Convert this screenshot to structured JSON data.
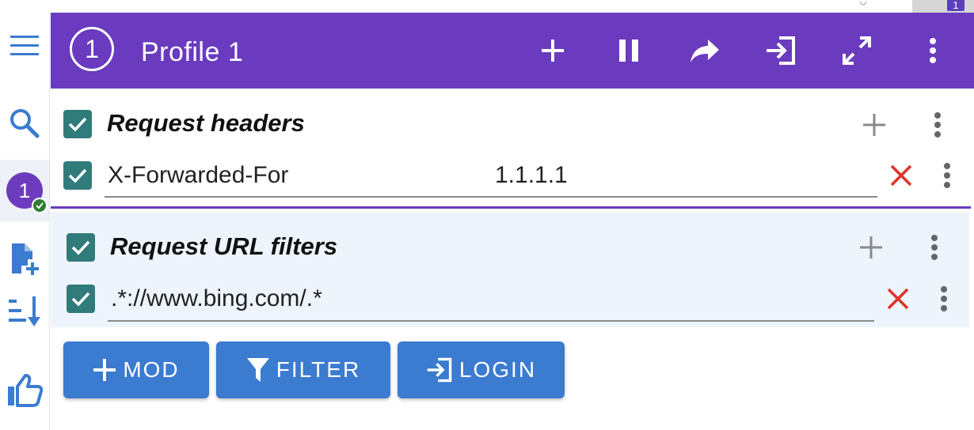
{
  "browser": {
    "extension_badge": "1"
  },
  "sidebar": {
    "profile_number": "1",
    "icons": [
      "menu-icon",
      "search-icon",
      "profile-avatar",
      "add-file-icon",
      "sort-icon",
      "thumbs-up-icon"
    ]
  },
  "header": {
    "profile_number": "1",
    "title": "Profile 1",
    "actions": [
      "add-icon",
      "pause-icon",
      "share-icon",
      "login-icon",
      "fullscreen-icon",
      "more-vert-icon"
    ],
    "background_color": "#6a3bbf"
  },
  "sections": [
    {
      "title": "Request headers",
      "checked": true,
      "rows": [
        {
          "checked": true,
          "name": "X-Forwarded-For",
          "value": "1.1.1.1"
        }
      ]
    },
    {
      "title": "Request URL filters",
      "checked": true,
      "rows": [
        {
          "checked": true,
          "name": ".*://www.bing.com/.*"
        }
      ]
    }
  ],
  "buttons": {
    "mod_label": "MOD",
    "filter_label": "FILTER",
    "login_label": "LOGIN"
  },
  "colors": {
    "checkbox": "#327b7b",
    "button": "#3b7bd0",
    "delete": "#e0312a",
    "accent": "#6a3bbf"
  }
}
